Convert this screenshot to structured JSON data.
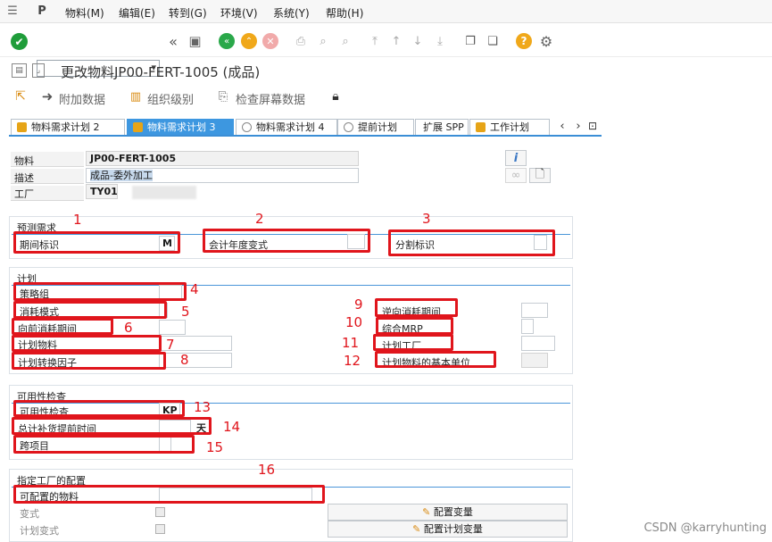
{
  "menu": {
    "items": [
      "物料(M)",
      "编辑(E)",
      "转到(G)",
      "环境(V)",
      "系统(Y)",
      "帮助(H)"
    ]
  },
  "toolbar": {
    "command_value": "",
    "icons": [
      "check-icon",
      "back-icon",
      "save-icon",
      "exit-icon",
      "cancel-icon",
      "print-icon",
      "find-icon",
      "first-page-icon",
      "prev-page-icon",
      "next-page-icon",
      "last-page-icon",
      "new-window-icon",
      "help-icon",
      "settings-icon"
    ]
  },
  "title": "更改物料JP00-FERT-1005 (成品)",
  "app_toolbar": {
    "additional_data": "附加数据",
    "org_levels": "组织级别",
    "check_screen_data": "检查屏幕数据"
  },
  "tabs": [
    "物料需求计划 2",
    "物料需求计划 3",
    "物料需求计划 4",
    "提前计划",
    "扩展 SPP",
    "工作计划"
  ],
  "header_fields": {
    "material_label": "物料",
    "material_value": "JP00-FERT-1005",
    "desc_label": "描述",
    "desc_value": "成品-委外加工",
    "plant_label": "工厂",
    "plant_value": "TY01"
  },
  "forecast": {
    "title": "预测需求",
    "period_indicator": "期间标识",
    "period_value": "M",
    "fiscal_variant": "会计年度变式",
    "split_indicator": "分割标识"
  },
  "planning": {
    "title": "计划",
    "strategy_group": "策略组",
    "consumption_mode": "消耗模式",
    "fwd_consumption": "向前消耗期间",
    "planning_material": "计划物料",
    "planning_conv_factor": "计划转换因子",
    "bwd_consumption": "逆向消耗期间",
    "mixed_mrp": "综合MRP",
    "planning_plant": "计划工厂",
    "planning_base_unit": "计划物料的基本单位"
  },
  "availability": {
    "title": "可用性检查",
    "avail_check": "可用性检查",
    "avail_value": "KP",
    "total_repl_lead": "总计补货提前时间",
    "unit": "天",
    "cross_project": "跨项目"
  },
  "plant_config": {
    "title": "指定工厂的配置",
    "configurable_material": "可配置的物料",
    "variant": "变式",
    "planning_variant": "计划变式",
    "config_variant_btn": "配置变量",
    "config_plan_variant_btn": "配置计划变量"
  },
  "annotations": [
    "1",
    "2",
    "3",
    "4",
    "5",
    "6",
    "7",
    "8",
    "9",
    "10",
    "11",
    "12",
    "13",
    "14",
    "15",
    "16"
  ],
  "watermark": "CSDN @karryhunting",
  "colors": {
    "accent": "#3d97e0",
    "annotation": "#e0151c",
    "check_green": "#1f9d3a"
  }
}
